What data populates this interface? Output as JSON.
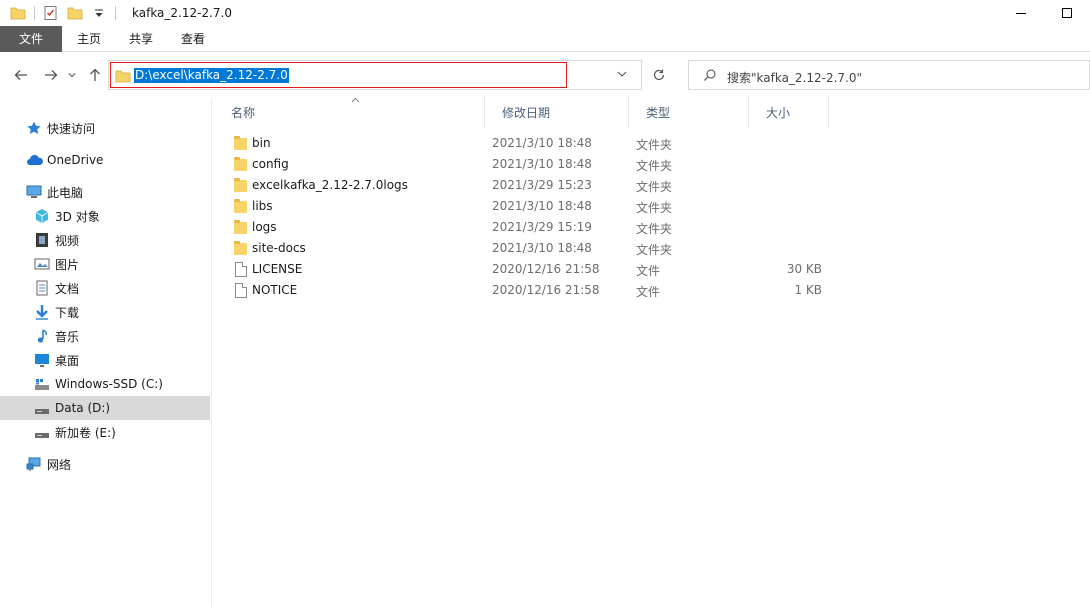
{
  "window": {
    "title": "kafka_2.12-2.7.0"
  },
  "ribbon": {
    "tabs": [
      "文件",
      "主页",
      "共享",
      "查看"
    ]
  },
  "address": {
    "path": "D:\\excel\\kafka_2.12-2.7.0"
  },
  "search": {
    "placeholder": "搜索\"kafka_2.12-2.7.0\""
  },
  "nav": {
    "items": [
      {
        "label": "快速访问",
        "icon": "star-icon"
      },
      {
        "label": "OneDrive",
        "icon": "cloud-icon"
      },
      {
        "label": "此电脑",
        "icon": "computer-icon"
      },
      {
        "label": "3D 对象",
        "icon": "cube-icon"
      },
      {
        "label": "视频",
        "icon": "video-icon"
      },
      {
        "label": "图片",
        "icon": "picture-icon"
      },
      {
        "label": "文档",
        "icon": "document-icon"
      },
      {
        "label": "下载",
        "icon": "download-icon"
      },
      {
        "label": "音乐",
        "icon": "music-icon"
      },
      {
        "label": "桌面",
        "icon": "desktop-icon"
      },
      {
        "label": "Windows-SSD (C:)",
        "icon": "drive-icon"
      },
      {
        "label": "Data (D:)",
        "icon": "drive-icon",
        "selected": true
      },
      {
        "label": "新加卷 (E:)",
        "icon": "drive-icon"
      },
      {
        "label": "网络",
        "icon": "network-icon"
      }
    ]
  },
  "columns": {
    "name": "名称",
    "date": "修改日期",
    "type": "类型",
    "size": "大小"
  },
  "files": [
    {
      "name": "bin",
      "date": "2021/3/10 18:48",
      "type": "文件夹",
      "size": "",
      "kind": "folder"
    },
    {
      "name": "config",
      "date": "2021/3/10 18:48",
      "type": "文件夹",
      "size": "",
      "kind": "folder"
    },
    {
      "name": "excelkafka_2.12-2.7.0logs",
      "date": "2021/3/29 15:23",
      "type": "文件夹",
      "size": "",
      "kind": "folder"
    },
    {
      "name": "libs",
      "date": "2021/3/10 18:48",
      "type": "文件夹",
      "size": "",
      "kind": "folder"
    },
    {
      "name": "logs",
      "date": "2021/3/29 15:19",
      "type": "文件夹",
      "size": "",
      "kind": "folder"
    },
    {
      "name": "site-docs",
      "date": "2021/3/10 18:48",
      "type": "文件夹",
      "size": "",
      "kind": "folder"
    },
    {
      "name": "LICENSE",
      "date": "2020/12/16 21:58",
      "type": "文件",
      "size": "30 KB",
      "kind": "file"
    },
    {
      "name": "NOTICE",
      "date": "2020/12/16 21:58",
      "type": "文件",
      "size": "1 KB",
      "kind": "file"
    }
  ],
  "colors": {
    "accent": "#0078d7",
    "file_tab": "#5a5a5a",
    "highlight_border": "#e01b1b",
    "selected_row": "#d9d9d9"
  }
}
